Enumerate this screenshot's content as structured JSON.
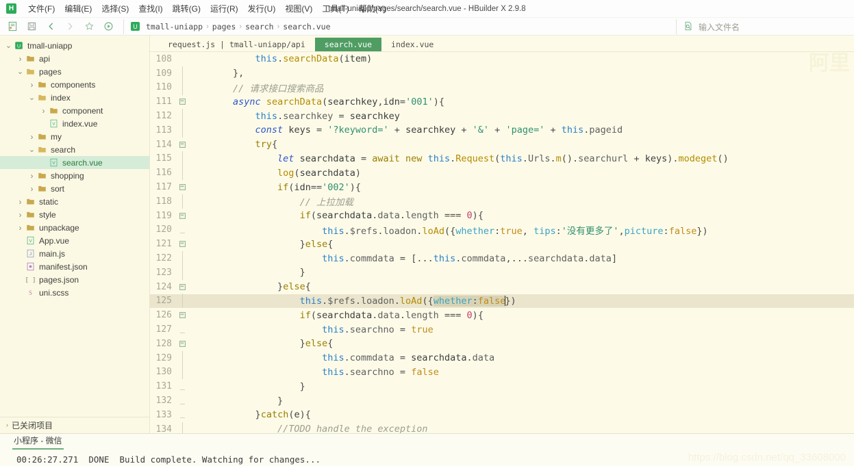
{
  "window": {
    "title": "tmall-uniapp/pages/search/search.vue - HBuilder X 2.9.8",
    "logo": "H"
  },
  "menubar": {
    "items": [
      {
        "label": "文件(F)",
        "name": "menu-file"
      },
      {
        "label": "编辑(E)",
        "name": "menu-edit"
      },
      {
        "label": "选择(S)",
        "name": "menu-select"
      },
      {
        "label": "查找(I)",
        "name": "menu-find"
      },
      {
        "label": "跳转(G)",
        "name": "menu-goto"
      },
      {
        "label": "运行(R)",
        "name": "menu-run"
      },
      {
        "label": "发行(U)",
        "name": "menu-publish"
      },
      {
        "label": "视图(V)",
        "name": "menu-view"
      },
      {
        "label": "工具(T)",
        "name": "menu-tools"
      },
      {
        "label": "帮助(Y)",
        "name": "menu-help"
      }
    ]
  },
  "toolbar": {
    "buttons": [
      {
        "name": "new-file-icon",
        "icon": "new-file"
      },
      {
        "name": "save-icon",
        "icon": "save"
      },
      {
        "name": "back-icon",
        "icon": "chevron-left"
      },
      {
        "name": "forward-icon",
        "icon": "chevron-right"
      },
      {
        "name": "favorite-icon",
        "icon": "star"
      },
      {
        "name": "run-icon",
        "icon": "play-circle"
      }
    ],
    "breadcrumb": {
      "logo": "U",
      "items": [
        "tmall-uniapp",
        "pages",
        "search",
        "search.vue"
      ],
      "separator": "›"
    },
    "filename_search": {
      "icon": "file-search-icon",
      "placeholder": "输入文件名",
      "value": ""
    }
  },
  "sidebar": {
    "tree": [
      {
        "label": "tmall-uniapp",
        "depth": 0,
        "arrow": "down",
        "icon": "project",
        "selected": false
      },
      {
        "label": "api",
        "depth": 1,
        "arrow": "right",
        "icon": "folder",
        "selected": false
      },
      {
        "label": "pages",
        "depth": 1,
        "arrow": "down",
        "icon": "folder-open",
        "selected": false
      },
      {
        "label": "components",
        "depth": 2,
        "arrow": "right",
        "icon": "folder",
        "selected": false
      },
      {
        "label": "index",
        "depth": 2,
        "arrow": "down",
        "icon": "folder-open",
        "selected": false
      },
      {
        "label": "component",
        "depth": 3,
        "arrow": "right",
        "icon": "folder",
        "selected": false
      },
      {
        "label": "index.vue",
        "depth": 3,
        "arrow": "none",
        "icon": "vue",
        "selected": false
      },
      {
        "label": "my",
        "depth": 2,
        "arrow": "right",
        "icon": "folder",
        "selected": false
      },
      {
        "label": "search",
        "depth": 2,
        "arrow": "down",
        "icon": "folder-open",
        "selected": false
      },
      {
        "label": "search.vue",
        "depth": 3,
        "arrow": "none",
        "icon": "vue",
        "selected": true
      },
      {
        "label": "shopping",
        "depth": 2,
        "arrow": "right",
        "icon": "folder",
        "selected": false
      },
      {
        "label": "sort",
        "depth": 2,
        "arrow": "right",
        "icon": "folder",
        "selected": false
      },
      {
        "label": "static",
        "depth": 1,
        "arrow": "right",
        "icon": "folder",
        "selected": false
      },
      {
        "label": "style",
        "depth": 1,
        "arrow": "right",
        "icon": "folder",
        "selected": false
      },
      {
        "label": "unpackage",
        "depth": 1,
        "arrow": "right",
        "icon": "folder",
        "selected": false
      },
      {
        "label": "App.vue",
        "depth": 1,
        "arrow": "none",
        "icon": "vue",
        "selected": false
      },
      {
        "label": "main.js",
        "depth": 1,
        "arrow": "none",
        "icon": "js",
        "selected": false
      },
      {
        "label": "manifest.json",
        "depth": 1,
        "arrow": "none",
        "icon": "json-o",
        "selected": false
      },
      {
        "label": "pages.json",
        "depth": 1,
        "arrow": "none",
        "icon": "json-b",
        "selected": false
      },
      {
        "label": "uni.scss",
        "depth": 1,
        "arrow": "none",
        "icon": "scss",
        "selected": false
      }
    ],
    "closed_projects": {
      "label": "已关闭项目",
      "arrow": "›"
    }
  },
  "editor": {
    "tabs": [
      {
        "label": "request.js | tmall-uniapp/api",
        "active": false,
        "name": "tab-request-js"
      },
      {
        "label": "search.vue",
        "active": true,
        "name": "tab-search-vue"
      },
      {
        "label": "index.vue",
        "active": false,
        "name": "tab-index-vue"
      }
    ],
    "first_line_number": 108,
    "current_line": 125,
    "minimap_watermark": "阿里",
    "lines": [
      {
        "n": 108,
        "fold": "none",
        "text": "            this.searchData(item)"
      },
      {
        "n": 109,
        "fold": "bar",
        "text": "        },"
      },
      {
        "n": 110,
        "fold": "bar",
        "text": "        // 请求接口搜索商品"
      },
      {
        "n": 111,
        "fold": "open",
        "text": "        async searchData(searchkey,idn='001'){"
      },
      {
        "n": 112,
        "fold": "bar",
        "text": "            this.searchkey = searchkey"
      },
      {
        "n": 113,
        "fold": "bar",
        "text": "            const keys = '?keyword=' + searchkey + '&' + 'page=' + this.pageid"
      },
      {
        "n": 114,
        "fold": "open",
        "text": "            try{"
      },
      {
        "n": 115,
        "fold": "bar",
        "text": "                let searchdata = await new this.Request(this.Urls.m().searchurl + keys).modeget()"
      },
      {
        "n": 116,
        "fold": "bar",
        "text": "                log(searchdata)"
      },
      {
        "n": 117,
        "fold": "open",
        "text": "                if(idn=='002'){"
      },
      {
        "n": 118,
        "fold": "bar",
        "text": "                    // 上拉加载"
      },
      {
        "n": 119,
        "fold": "open",
        "text": "                    if(searchdata.data.length === 0){"
      },
      {
        "n": 120,
        "fold": "dash",
        "text": "                        this.$refs.loadon.loAd({whether:true, tips:'没有更多了',picture:false})"
      },
      {
        "n": 121,
        "fold": "open",
        "text": "                    }else{"
      },
      {
        "n": 122,
        "fold": "bar",
        "text": "                        this.commdata = [...this.commdata,...searchdata.data]"
      },
      {
        "n": 123,
        "fold": "bar",
        "text": "                    }"
      },
      {
        "n": 124,
        "fold": "open",
        "text": "                }else{"
      },
      {
        "n": 125,
        "fold": "bar",
        "text": "                    this.$refs.loadon.loAd({whether:false})"
      },
      {
        "n": 126,
        "fold": "open",
        "text": "                    if(searchdata.data.length === 0){"
      },
      {
        "n": 127,
        "fold": "dash",
        "text": "                        this.searchno = true"
      },
      {
        "n": 128,
        "fold": "open",
        "text": "                    }else{"
      },
      {
        "n": 129,
        "fold": "bar",
        "text": "                        this.commdata = searchdata.data"
      },
      {
        "n": 130,
        "fold": "bar",
        "text": "                        this.searchno = false"
      },
      {
        "n": 131,
        "fold": "dash",
        "text": "                    }"
      },
      {
        "n": 132,
        "fold": "dash",
        "text": "                }"
      },
      {
        "n": 133,
        "fold": "dash",
        "text": "            }catch(e){"
      },
      {
        "n": 134,
        "fold": "bar",
        "text": "                //TODO handle the exception"
      }
    ],
    "selection": {
      "line": 125,
      "text": "whether:false"
    }
  },
  "bottom_panel": {
    "tabs": [
      {
        "label": "小程序 - 微信",
        "active": true,
        "name": "panel-tab-mp-weixin"
      }
    ],
    "console": "00:26:27.271  DONE  Build complete. Watching for changes..."
  },
  "watermark": "https://blog.csdn.net/qq_33608000",
  "colors": {
    "accent": "#4f9d63",
    "editor_bg": "#fdfbe8",
    "sidebar_bg": "#fbf9e3",
    "selected_row": "#d5ecd8",
    "current_line": "#eae5cc"
  }
}
